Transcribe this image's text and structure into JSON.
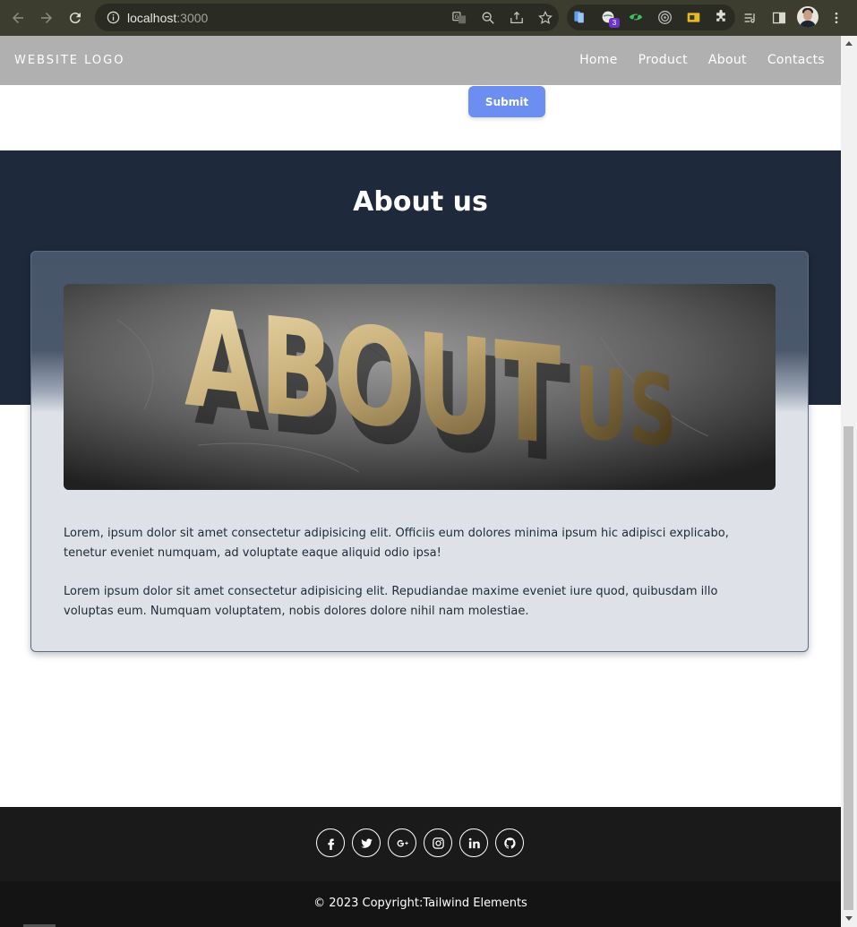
{
  "browser": {
    "url_host": "localhost",
    "url_port": ":3000",
    "extension_badge": "3"
  },
  "navbar": {
    "logo": "WEBSITE LOGO",
    "items": [
      "Home",
      "Product",
      "About",
      "Contacts"
    ]
  },
  "form": {
    "submit_label": "Submit"
  },
  "about": {
    "title": "About us",
    "image_text": "ABOUT US",
    "paragraphs": [
      "Lorem, ipsum dolor sit amet consectetur adipisicing elit. Officiis eum dolores minima ipsum hic adipisci explicabo, tenetur eveniet numquam, ad voluptate eaque aliquid odio ipsa!",
      "Lorem ipsum dolor sit amet consectetur adipisicing elit. Repudiandae maxime eveniet iure quod, quibusdam illo voluptas eum. Numquam voluptatem, nobis dolores dolore nihil nam molestiae."
    ]
  },
  "footer": {
    "social_icons": [
      "facebook-icon",
      "twitter-icon",
      "google-plus-icon",
      "instagram-icon",
      "linkedin-icon",
      "github-icon"
    ],
    "copyright": "© 2023 Copyright:Tailwind Elements"
  },
  "colors": {
    "navbar_bg": "#b0b0b0",
    "about_band": "#1e293b",
    "submit_bg": "#6b8ef0",
    "footer_bg": "#1a1a1a"
  }
}
